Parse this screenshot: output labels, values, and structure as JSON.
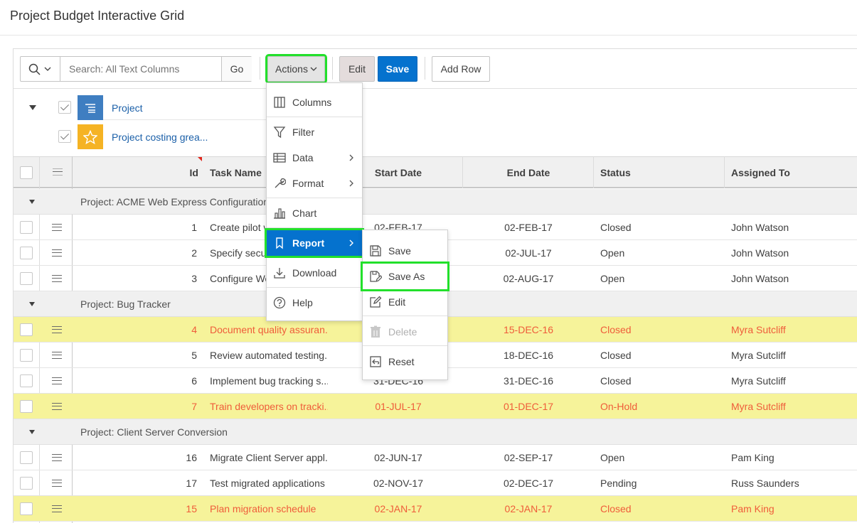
{
  "page_title": "Project Budget Interactive Grid",
  "toolbar": {
    "search_placeholder": "Search: All Text Columns",
    "go_label": "Go",
    "actions_label": "Actions",
    "edit_label": "Edit",
    "save_label": "Save",
    "add_row_label": "Add Row"
  },
  "reports": [
    {
      "label": "Project",
      "icon": "report-list-icon",
      "checked": true
    },
    {
      "label": "Project costing grea...",
      "icon": "star-icon",
      "checked": true
    }
  ],
  "columns": [
    "Id",
    "Task Name",
    "Start Date",
    "End Date",
    "Status",
    "Assigned To"
  ],
  "groups": [
    {
      "label": "Project: ACME Web Express Configuration",
      "rows": [
        {
          "id": "1",
          "task": "Create pilot w",
          "start": "02-FEB-17",
          "end": "02-FEB-17",
          "status": "Closed",
          "assigned": "John Watson",
          "highlight": false
        },
        {
          "id": "2",
          "task": "Specify secur",
          "start": "",
          "end": "02-JUL-17",
          "status": "Open",
          "assigned": "John Watson",
          "highlight": false
        },
        {
          "id": "3",
          "task": "Configure Wo",
          "start": "",
          "end": "02-AUG-17",
          "status": "Open",
          "assigned": "John Watson",
          "highlight": false
        }
      ]
    },
    {
      "label": "Project: Bug Tracker",
      "rows": [
        {
          "id": "4",
          "task": "Document quality assuran...",
          "start": "",
          "end": "15-DEC-16",
          "status": "Closed",
          "assigned": "Myra Sutcliff",
          "highlight": true
        },
        {
          "id": "5",
          "task": "Review automated testing...",
          "start": "",
          "end": "18-DEC-16",
          "status": "Closed",
          "assigned": "Myra Sutcliff",
          "highlight": false
        },
        {
          "id": "6",
          "task": "Implement bug tracking s...",
          "start": "31-DEC-16",
          "end": "31-DEC-16",
          "status": "Closed",
          "assigned": "Myra Sutcliff",
          "highlight": false
        },
        {
          "id": "7",
          "task": "Train developers on tracki...",
          "start": "01-JUL-17",
          "end": "01-DEC-17",
          "status": "On-Hold",
          "assigned": "Myra Sutcliff",
          "highlight": true
        }
      ]
    },
    {
      "label": "Project: Client Server Conversion",
      "rows": [
        {
          "id": "16",
          "task": "Migrate Client Server appl...",
          "start": "02-JUN-17",
          "end": "02-SEP-17",
          "status": "Open",
          "assigned": "Pam King",
          "highlight": false
        },
        {
          "id": "17",
          "task": "Test migrated applications",
          "start": "02-NOV-17",
          "end": "02-DEC-17",
          "status": "Pending",
          "assigned": "Russ Saunders",
          "highlight": false
        },
        {
          "id": "15",
          "task": "Plan migration schedule",
          "start": "02-JAN-17",
          "end": "02-JAN-17",
          "status": "Closed",
          "assigned": "Pam King",
          "highlight": true
        }
      ]
    }
  ],
  "actions_menu": {
    "items": [
      {
        "label": "Columns",
        "icon": "columns-icon"
      },
      {
        "label": "Filter",
        "icon": "filter-icon"
      },
      {
        "label": "Data",
        "icon": "table-icon",
        "submenu": true
      },
      {
        "label": "Format",
        "icon": "wrench-icon",
        "submenu": true
      },
      {
        "label": "Chart",
        "icon": "bar-chart-icon"
      },
      {
        "label": "Report",
        "icon": "bookmark-icon",
        "submenu": true,
        "active": true
      },
      {
        "label": "Download",
        "icon": "download-icon"
      },
      {
        "label": "Help",
        "icon": "help-icon"
      }
    ]
  },
  "report_menu": {
    "items": [
      {
        "label": "Save",
        "icon": "floppy-icon"
      },
      {
        "label": "Save As",
        "icon": "save-as-icon"
      },
      {
        "label": "Edit",
        "icon": "pencil-icon"
      },
      {
        "label": "Delete",
        "icon": "trash-icon",
        "disabled": true
      },
      {
        "label": "Reset",
        "icon": "reset-icon"
      }
    ]
  },
  "colors": {
    "primary": "#0572ce",
    "highlight_row": "#f6f39a",
    "highlight_text": "#ef5c3a",
    "annotation": "#22e02b",
    "report_blue": "#3f7ec1",
    "report_star": "#f5b324"
  }
}
